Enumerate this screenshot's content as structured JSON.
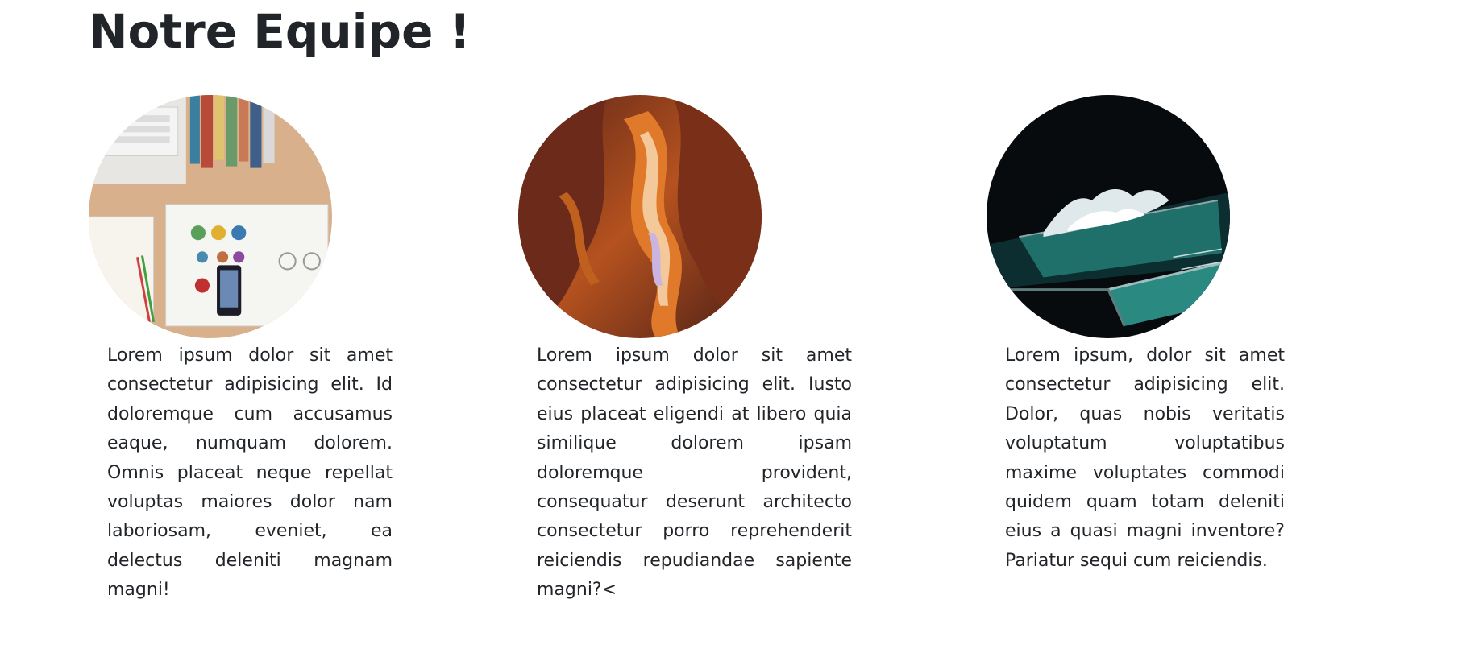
{
  "page": {
    "title": "Notre Equipe !"
  },
  "team": [
    {
      "photo_subject": "desk-workspace",
      "bio": "Lorem ipsum dolor sit amet consectetur adipisicing elit. Id doloremque cum accusamus eaque, numquam dolorem. Omnis placeat neque repellat voluptas maiores dolor nam laboriosam, eveniet, ea delectus deleniti magnam magni!"
    },
    {
      "photo_subject": "slot-canyon",
      "bio": "Lorem ipsum dolor sit amet consectetur adipisicing elit. Iusto eius placeat eligendi at libero quia similique dolorem ipsam doloremque provident, consequatur deserunt architecto consectetur porro reprehenderit reiciendis repudiandae sapiente magni?<"
    },
    {
      "photo_subject": "ocean-pool-night",
      "bio": "Lorem ipsum, dolor sit amet consectetur adipisicing elit. Dolor, quas nobis veritatis voluptatum voluptatibus maxime voluptates commodi quidem quam totam deleniti eius a quasi magni inventore? Pariatur sequi cum reiciendis."
    }
  ],
  "colors": {
    "text": "#212529",
    "background": "#ffffff"
  }
}
